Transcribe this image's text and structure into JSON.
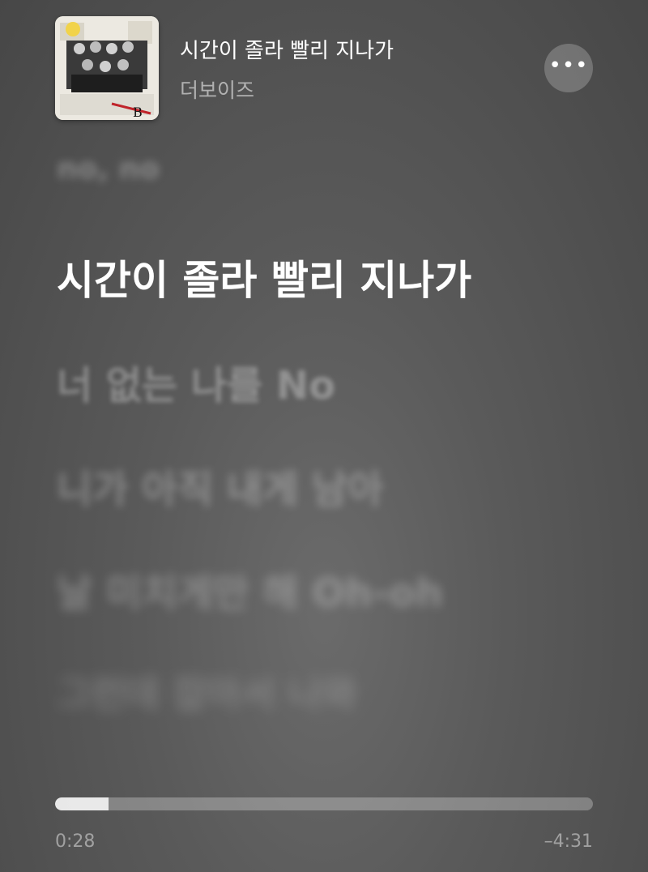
{
  "header": {
    "song_title": "시간이 졸라 빨리 지나가",
    "artist": "더보이즈",
    "more_label": "•••"
  },
  "lyrics": {
    "previous": "no, no",
    "current": "시간이 졸라 빨리 지나가",
    "next": [
      "너 없는 나를 No",
      "니가 아직 내게 남아",
      "날 미치게만 해 Oh-oh",
      "그런데 잡아서 나와"
    ]
  },
  "playback": {
    "elapsed": "0:28",
    "remaining": "–4:31",
    "progress_fraction": 0.1
  },
  "colors": {
    "background": "#5a5a5a",
    "current_lyric": "#ffffff",
    "progress_fill": "#d1d1d1"
  }
}
